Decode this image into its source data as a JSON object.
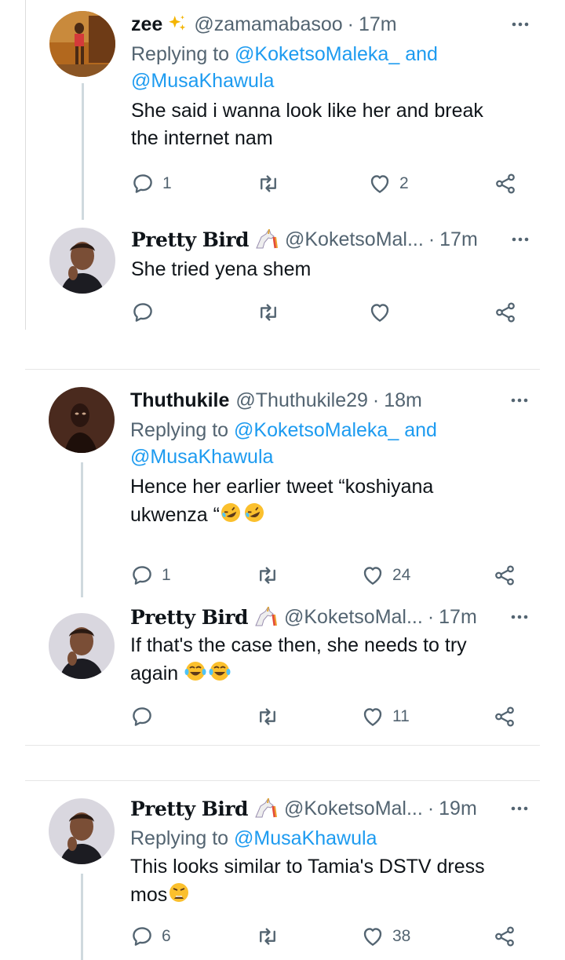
{
  "colors": {
    "text": "#0f1419",
    "muted": "#536471",
    "link": "#1d9bf0",
    "thread": "#cfd9de"
  },
  "tweets": [
    {
      "name": "zee",
      "name_badge": "sparkles-emoji",
      "handle": "@zamamabasoo",
      "time": "17m",
      "reply_prefix": "Replying to",
      "mention1": "@KoketsoMaleka_",
      "and": "and",
      "mention2": "@MusaKhawula",
      "text_line1": "She said i wanna look like her and break",
      "text_line2": "the internet nam",
      "replies": "1",
      "retweets": "",
      "likes": "2"
    },
    {
      "name": "Pretty Bird",
      "name_badge": "unicorn-emoji",
      "handle": "@KoketsoMal...",
      "time": "17m",
      "text_line1": "She tried yena shem",
      "replies": "",
      "retweets": "",
      "likes": ""
    },
    {
      "name": "Thuthukile",
      "handle": "@Thuthukile29",
      "time": "18m",
      "reply_prefix": "Replying to",
      "mention1": "@KoketsoMaleka_",
      "and": "and",
      "mention2": "@MusaKhawula",
      "text_line1": "Hence her earlier tweet “koshiyana",
      "text_line2": "ukwenza “",
      "text_emoji": "rolling-on-floor-laughing-emoji x2",
      "replies": "1",
      "retweets": "",
      "likes": "24"
    },
    {
      "name": "Pretty Bird",
      "name_badge": "unicorn-emoji",
      "handle": "@KoketsoMal...",
      "time": "17m",
      "text_line1": "If that's the case then, she needs to try",
      "text_line2": "again",
      "text_emoji": "tears-of-joy-emoji x2",
      "replies": "",
      "retweets": "",
      "likes": "11"
    },
    {
      "name": "Pretty Bird",
      "name_badge": "unicorn-emoji",
      "handle": "@KoketsoMal...",
      "time": "19m",
      "reply_prefix": "Replying to",
      "mention1": "@MusaKhawula",
      "text_line1": "This looks similar to Tamia's DSTV dress",
      "text_line2": "mos",
      "text_emoji": "weary-face-emoji",
      "replies": "6",
      "retweets": "",
      "likes": "38"
    }
  ]
}
